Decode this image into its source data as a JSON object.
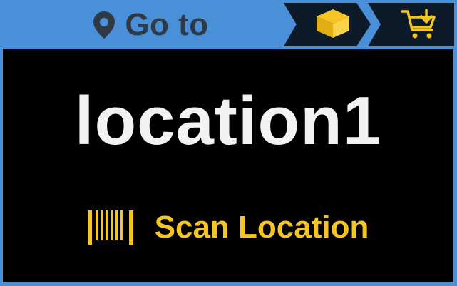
{
  "header": {
    "title": "Go to",
    "title_icon": "map-pin-icon",
    "actions": [
      {
        "icon": "box-icon",
        "label": ""
      },
      {
        "icon": "cart-return-icon",
        "label": ""
      }
    ]
  },
  "main": {
    "location": "location1",
    "scan_label": "Scan Location",
    "scan_icon": "barcode-icon"
  },
  "colors": {
    "header_bg": "#4a90d9",
    "header_text": "#2f3a45",
    "chevron_bg": "#0d1a2a",
    "panel_bg": "#000000",
    "location_text": "#f2f2f2",
    "accent_yellow": "#f5c524"
  }
}
